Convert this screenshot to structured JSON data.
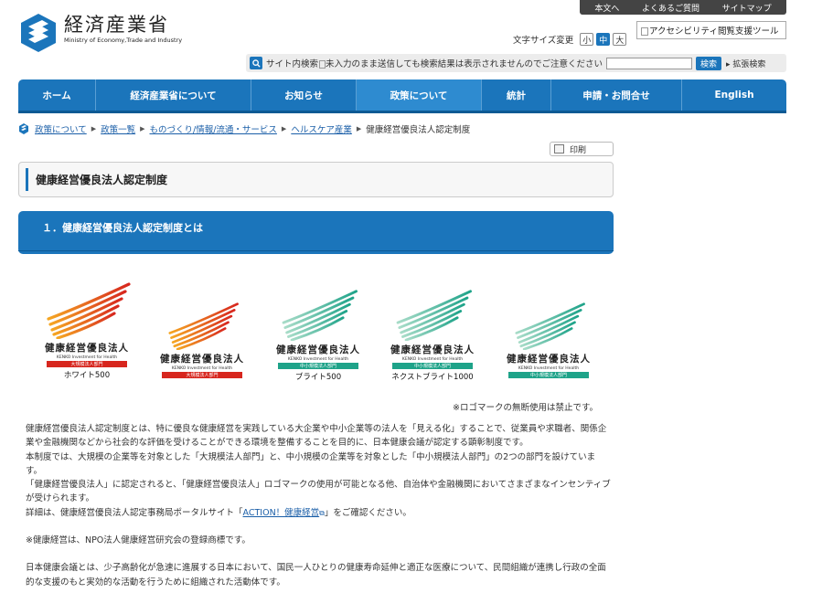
{
  "utility_nav": [
    "本文へ",
    "よくあるご質問",
    "サイトマップ"
  ],
  "logo": {
    "jp": "経済産業省",
    "en": "Ministry of Economy,Trade and Industry"
  },
  "font_size": {
    "label": "文字サイズ変更",
    "small": "小",
    "medium": "中",
    "large": "大",
    "selected": "中"
  },
  "accessibility_tool": "アクセシビリティ閲覧支援ツール",
  "search": {
    "label": "サイト内検索",
    "placeholder": "未入力のまま送信しても検索結果は表示されませんのでご注意ください",
    "value": "",
    "button": "検索",
    "advanced": "拡張検索"
  },
  "nav": [
    {
      "label": "ホーム"
    },
    {
      "label": "経済産業省について"
    },
    {
      "label": "お知らせ"
    },
    {
      "label": "政策について"
    },
    {
      "label": "統計"
    },
    {
      "label": "申請・お問合せ"
    },
    {
      "label": "English"
    }
  ],
  "nav_active": "政策について",
  "breadcrumb": [
    "政策について",
    "政策一覧",
    "ものづくり/情報/流通・サービス",
    "ヘルスケア産業"
  ],
  "breadcrumb_current": "健康経営優良法人認定制度",
  "print_label": "印刷",
  "page_title": "健康経営優良法人認定制度",
  "section_heading": "１．健康経営優良法人認定制度とは",
  "logos": [
    {
      "title": "健康経営優良法人",
      "en": "KENKO Investment for Health",
      "band": "大規模法人部門",
      "sub": "ホワイト500",
      "color": "red"
    },
    {
      "title": "健康経営優良法人",
      "en": "KENKO Investment for Health",
      "band": "大規模法人部門",
      "sub": "",
      "color": "red"
    },
    {
      "title": "健康経営優良法人",
      "en": "KENKO Investment for Health",
      "band": "中小規模法人部門",
      "sub": "ブライト500",
      "color": "green"
    },
    {
      "title": "健康経営優良法人",
      "en": "KENKO Investment for Health",
      "band": "中小規模法人部門",
      "sub": "ネクストブライト1000",
      "color": "green"
    },
    {
      "title": "健康経営優良法人",
      "en": "KENKO Investment for Health",
      "band": "中小規模法人部門",
      "sub": "",
      "color": "green"
    }
  ],
  "logo_note": "※ロゴマークの無断使用は禁止です。",
  "body": {
    "p1": "健康経営優良法人認定制度とは、特に優良な健康経営を実践している大企業や中小企業等の法人を「見える化」することで、従業員や求職者、関係企業や金融機関などから社会的な評価を受けることができる環境を整備することを目的に、日本健康会議が認定する顕彰制度です。",
    "p2": "本制度では、大規模の企業等を対象とした「大規模法人部門」と、中小規模の企業等を対象とした「中小規模法人部門」の2つの部門を設けています。",
    "p3": "「健康経営優良法人」に認定されると、「健康経営優良法人」ロゴマークの使用が可能となる他、自治体や金融機関においてさまざまなインセンティブが受けられます。",
    "p4_pre": "詳細は、健康経営優良法人認定事務局ポータルサイト「",
    "p4_link": "ACTION！健康経営",
    "p4_post": "」をご確認ください。",
    "p5": "※健康経営は、NPO法人健康経営研究会の登録商標です。",
    "p6": "日本健康会議とは、少子高齢化が急速に進展する日本において、国民一人ひとりの健康寿命延伸と適正な医療について、民間組織が連携し行政の全面的な支援のもと実効的な活動を行うために組織された活動体です。"
  },
  "colors": {
    "primary": "#1b75bb",
    "red_band": "#d7261e",
    "green_band": "#1ea389"
  }
}
